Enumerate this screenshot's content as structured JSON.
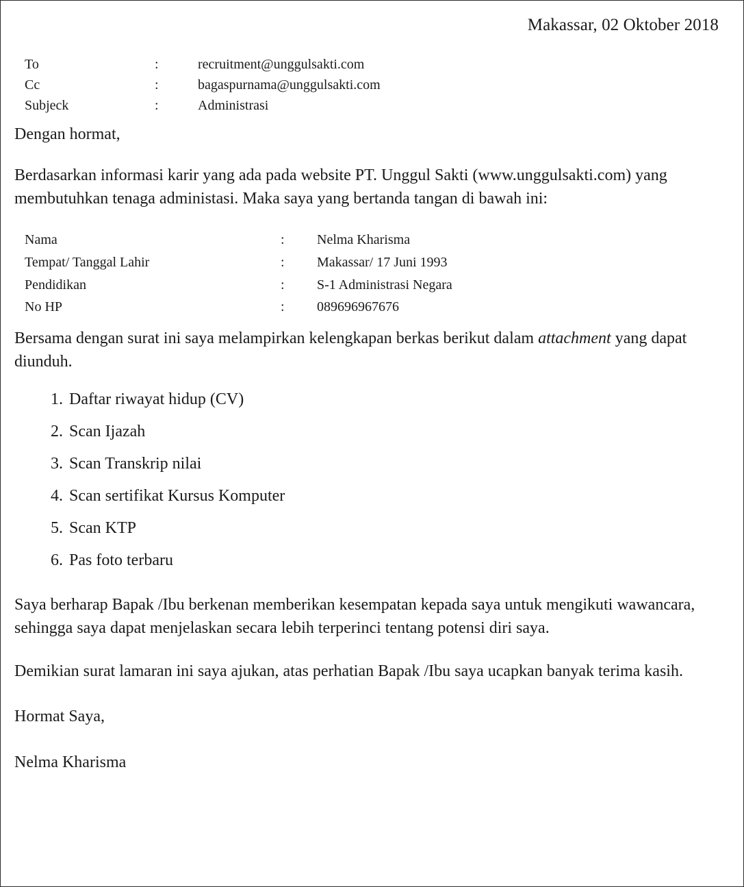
{
  "document": {
    "date_line": "Makassar, 02 Oktober 2018",
    "header_fields": [
      {
        "label": "To",
        "separator": ":",
        "value": "recruitment@unggulsakti.com"
      },
      {
        "label": "Cc",
        "separator": ":",
        "value": "bagaspurnama@unggulsakti.com"
      },
      {
        "label": "Subjeck",
        "separator": ":",
        "value": "Administrasi"
      }
    ],
    "salutation": "Dengan hormat,",
    "intro_paragraph": "Berdasarkan informasi karir yang ada pada website PT. Unggul Sakti (www.unggulsakti.com) yang membutuhkan tenaga administasi. Maka saya yang bertanda tangan di bawah ini:",
    "personal_details": [
      {
        "label": "Nama",
        "separator": ":",
        "value": "Nelma Kharisma"
      },
      {
        "label": "Tempat/ Tanggal Lahir",
        "separator": ":",
        "value": "Makassar/ 17 Juni 1993"
      },
      {
        "label": "Pendidikan",
        "separator": ":",
        "value": "S-1 Administrasi Negara"
      },
      {
        "label": "No HP",
        "separator": ":",
        "value": "089696967676"
      }
    ],
    "attachment_intro": {
      "part_1": "Bersama dengan surat ini saya melampirkan kelengkapan berkas berikut dalam ",
      "emphasis": "attachment",
      "part_2": " yang dapat diunduh."
    },
    "attachment_list": [
      {
        "number": "1.",
        "text": "Daftar riwayat hidup (CV)"
      },
      {
        "number": "2.",
        "text": "Scan Ijazah"
      },
      {
        "number": "3.",
        "text": "Scan Transkrip nilai"
      },
      {
        "number": "4.",
        "text": "Scan sertifikat Kursus Komputer"
      },
      {
        "number": "5.",
        "text": "Scan KTP"
      },
      {
        "number": "6.",
        "text": "Pas foto terbaru"
      }
    ],
    "closing_paragraph_1": "Saya berharap Bapak /Ibu berkenan memberikan kesempatan kepada saya untuk mengikuti wawancara, sehingga saya dapat menjelaskan secara lebih terperinci tentang potensi diri saya.",
    "closing_paragraph_2": "Demikian surat lamaran ini saya ajukan, atas perhatian Bapak /Ibu saya ucapkan banyak terima kasih.",
    "sign_off": "Hormat Saya,",
    "signature_name": "Nelma Kharisma"
  }
}
